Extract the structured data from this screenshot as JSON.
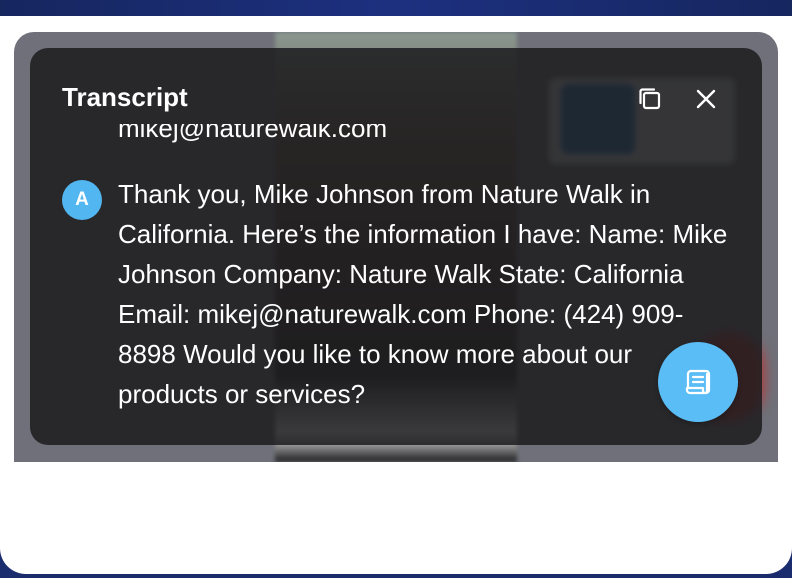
{
  "transcript": {
    "title": "Transcript",
    "previous_line": "mikej@naturewalk.com",
    "message": {
      "avatar_initial": "A",
      "text": "Thank you, Mike Johnson from Nature Walk in California. Here’s the information I have: Name: Mike Johnson Company: Nature Walk State: California Email: mikej@naturewalk.com Phone: (424) 909-8898 Would you like to know more about our products or services?"
    },
    "actions": {
      "copy_icon": "copy-icon",
      "close_icon": "close-icon",
      "transcript_toggle_icon": "scroll-icon"
    }
  },
  "colors": {
    "accent": "#5bbdf5",
    "avatar": "#52b6f0",
    "panel": "#1c1c1e"
  }
}
